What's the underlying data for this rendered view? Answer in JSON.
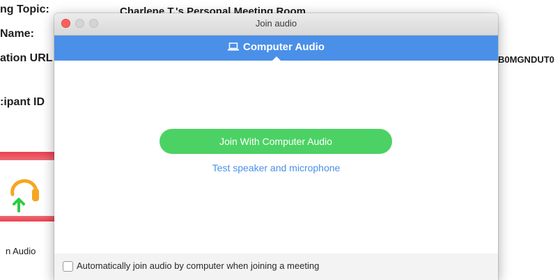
{
  "background": {
    "meeting_topic_label": "ng Topic:",
    "meeting_topic_value": "Charlene T.'s Personal Meeting Room",
    "name_label": "Name:",
    "invitation_url_label": "ation URL",
    "invitation_url_value": "B0MGNDUT0",
    "participant_id_label": ":ipant ID",
    "tile_label": "n Audio"
  },
  "dialog": {
    "title": "Join audio",
    "tab": {
      "label": "Computer Audio",
      "icon": "laptop-icon"
    },
    "join_button_label": "Join With Computer Audio",
    "test_link_label": "Test speaker and microphone",
    "auto_join_checkbox": {
      "label": "Automatically join audio by computer when joining a meeting",
      "checked": false
    }
  },
  "colors": {
    "accent_blue": "#4a90e8",
    "join_green": "#4cd264",
    "close_red": "#fc605c",
    "bg_red": "#e9424f",
    "phone_orange": "#f5a623",
    "arrow_green": "#2ecc40"
  }
}
